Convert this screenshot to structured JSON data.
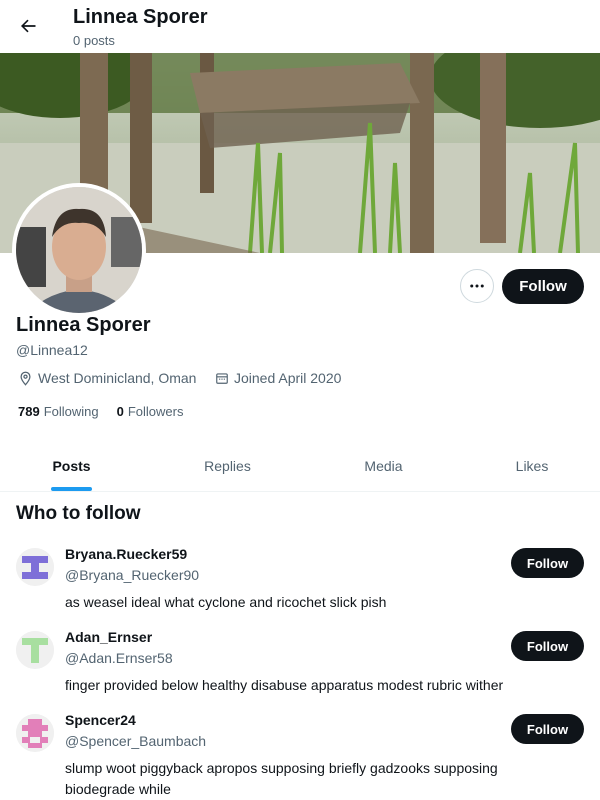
{
  "header": {
    "title": "Linnea Sporer",
    "subtitle": "0 posts"
  },
  "profile": {
    "name": "Linnea Sporer",
    "handle": "@Linnea12",
    "location": "West Dominicland, Oman",
    "joined": "Joined April 2020",
    "following_count": "789",
    "following_label": "Following",
    "followers_count": "0",
    "followers_label": "Followers",
    "follow_label": "Follow"
  },
  "tabs": [
    {
      "label": "Posts"
    },
    {
      "label": "Replies"
    },
    {
      "label": "Media"
    },
    {
      "label": "Likes"
    }
  ],
  "who_to_follow": {
    "title": "Who to follow",
    "users": [
      {
        "name": "Bryana.Ruecker59",
        "handle": "@Bryana_Ruecker90",
        "bio": "as weasel ideal what cyclone and ricochet slick pish",
        "follow_label": "Follow",
        "avatar_color": "#7e6fd8"
      },
      {
        "name": "Adan_Ernser",
        "handle": "@Adan.Ernser58",
        "bio": "finger provided below healthy disabuse apparatus modest rubric wither",
        "follow_label": "Follow",
        "avatar_color": "#a8dfa0"
      },
      {
        "name": "Spencer24",
        "handle": "@Spencer_Baumbach",
        "bio": "slump woot piggyback apropos supposing briefly gadzooks supposing biodegrade while",
        "follow_label": "Follow",
        "avatar_color": "#e27fb9"
      }
    ]
  }
}
